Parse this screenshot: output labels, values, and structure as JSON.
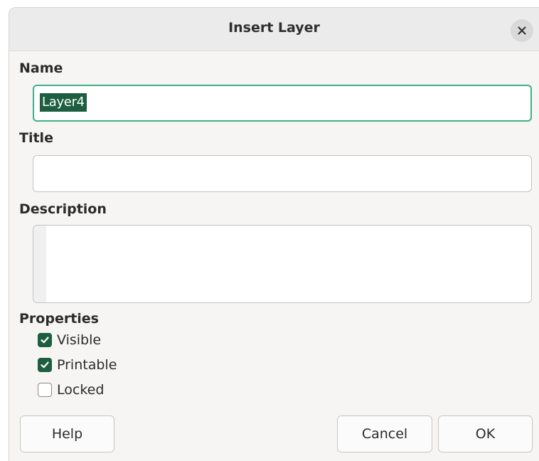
{
  "dialog": {
    "title": "Insert Layer",
    "close_icon": "close-icon"
  },
  "name": {
    "label": "Name",
    "value": "Layer4"
  },
  "title_field": {
    "label": "Title",
    "value": ""
  },
  "description": {
    "label": "Description",
    "value": ""
  },
  "properties": {
    "label": "Properties",
    "items": [
      {
        "label": "Visible",
        "checked": true
      },
      {
        "label": "Printable",
        "checked": true
      },
      {
        "label": "Locked",
        "checked": false
      }
    ]
  },
  "buttons": {
    "help": "Help",
    "cancel": "Cancel",
    "ok": "OK"
  },
  "colors": {
    "accent": "#1c5e3f",
    "focus_border": "#3db08a"
  }
}
